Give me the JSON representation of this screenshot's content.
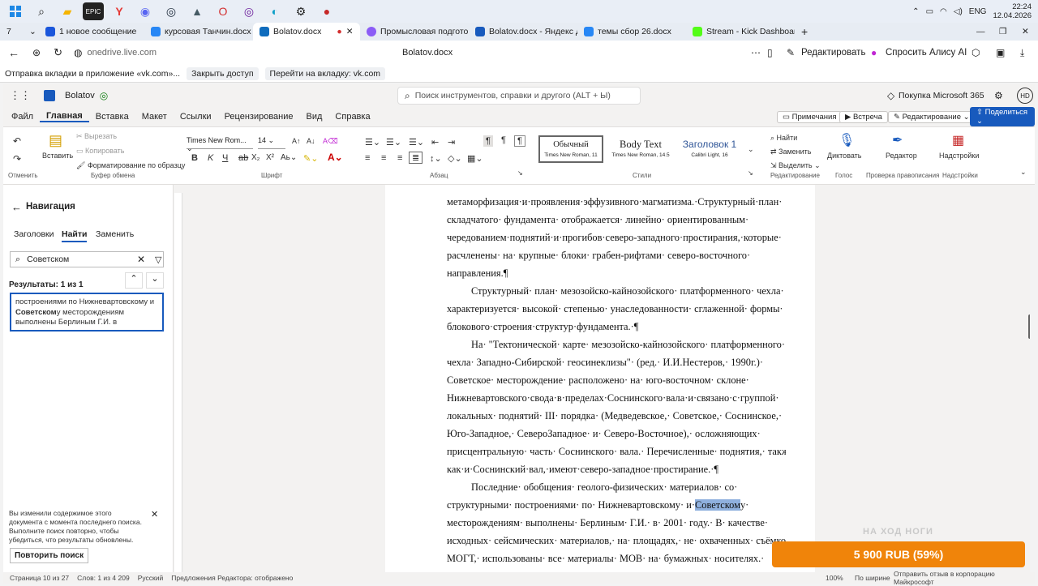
{
  "taskbar": {
    "clock_time": "22:24",
    "clock_date": "12.04.2026",
    "lang": "ENG"
  },
  "browser": {
    "tab_count": "7",
    "tabs": [
      {
        "label": "1 новое сообщение",
        "color": "#1a56db"
      },
      {
        "label": "курсовая Танчин.docx",
        "color": "#2787f5"
      },
      {
        "label": "Bolatov.docx",
        "color": "#0f6cbd"
      },
      {
        "label": "Промысловая подготовк",
        "color": "#8b5cf6"
      },
      {
        "label": "Bolatov.docx - Яндекс До",
        "color": "#185abd"
      },
      {
        "label": "темы сбор 26.docx",
        "color": "#2787f5"
      },
      {
        "label": "Stream - Kick Dashboard",
        "color": "#53fc18"
      }
    ],
    "url": "onedrive.live.com",
    "page_title": "Bolatov.docx",
    "edit_label": "Редактировать",
    "alice_label": "Спросить Алису AI",
    "infobar_text": "Отправка вкладки в приложение «vk.com»...",
    "infobar_close": "Закрыть доступ",
    "infobar_go": "Перейти на вкладку: vk.com"
  },
  "word": {
    "doc_name": "Bolatov",
    "search_placeholder": "Поиск инструментов, справки и другого (ALT + Ы)",
    "buy_label": "Покупка Microsoft 365",
    "avatar": "HD",
    "menu": [
      "Файл",
      "Главная",
      "Вставка",
      "Макет",
      "Ссылки",
      "Рецензирование",
      "Вид",
      "Справка"
    ],
    "actions": {
      "comments": "Примечания",
      "meeting": "Встреча",
      "editing": "Редактирование",
      "share": "Поделиться"
    },
    "ribbon": {
      "undo": "Отменить",
      "paste": "Вставить",
      "cut": "Вырезать",
      "copy": "Копировать",
      "format_painter": "Форматирование по образцу",
      "clipboard": "Буфер обмена",
      "font_name": "Times New Rom...",
      "font_size": "14",
      "font_group": "Шрифт",
      "paragraph_group": "Абзац",
      "styles_group": "Стили",
      "styles": [
        {
          "name": "Обычный",
          "sub": "Times New Roman, 11"
        },
        {
          "name": "Body Text",
          "sub": "Times New Roman, 14.5"
        },
        {
          "name": "Заголовок 1",
          "sub": "Calibri Light, 16"
        }
      ],
      "find": "Найти",
      "replace": "Заменить",
      "select": "Выделить",
      "editing_group": "Редактирование",
      "dictate": "Диктовать",
      "voice_group": "Голос",
      "editor": "Редактор",
      "proofing_group": "Проверка правописания",
      "addins": "Надстройки",
      "addins_group": "Надстройки"
    }
  },
  "nav": {
    "title": "Навигация",
    "tabs": [
      "Заголовки",
      "Найти",
      "Заменить"
    ],
    "search_value": "Советском",
    "results": "Результаты: 1 из 1",
    "result_line1": "построениями по Нижневартовскому и",
    "result_bold": "Советском",
    "result_line2": "у месторождениям",
    "result_line3": "выполнены Берлиным Г.И. в",
    "notice": "Вы изменили содержимое этого документа с момента последнего поиска. Выполните поиск повторно, чтобы убедиться, что результаты обновлены.",
    "repeat_button": "Повторить поиск"
  },
  "document": {
    "lines": [
      "метаморфизация·и·проявления·эффузивного·магматизма.·Структурный·план·",
      "складчатого· фундамента· отображается· линейно· ориентированным·",
      "чередованием·поднятий·и·прогибов·северо-западного·простирания,·которые·",
      "расчленены· на· крупные· блоки· грабен-рифтами· северо-восточного·",
      "направления.¶",
      "Структурный· план· мезозойско-кайнозойского· платформенного· чехла·",
      "характеризуется· высокой· степенью· унаследованности· сглаженной· формы·",
      "блокового·строения·структур·фундамента.·¶",
      "На· \"Тектонической· карте· мезозойско-кайнозойского· платформенного·",
      "чехла· Западно-Сибирской· геосинеклизы\"· (ред.· И.И.Нестеров,· 1990г.)·",
      "Советское· месторождение· расположено· на· юго-восточном· склоне·",
      "Нижневартовского·свода·в·пределах·Соснинского·вала·и·связано·с·группой·",
      "локальных· поднятий· III· порядка· (Медведевское,· Советское,· Соснинское,·",
      "Юго-Западное,· СевероЗападное· и· Северо-Восточное),· осложняющих·",
      "присцентральную· часть· Соснинского· вала.· Перечисленные· поднятия,· также·",
      "как·и·Соснинский·вал,·имеют·северо-западное·простирание.·¶",
      "Последние· обобщения· геолого-физических· материалов· со·",
      "структурными· построениями· по· Нижневартовскому· и·",
      "месторождениям· выполнены· Берлиным· Г.И.· в· 2001· году.· В· качестве·",
      "исходных· сейсмических· материалов,· на· площадях,· не· охваченных· съёмкой·",
      "МОГТ,· использованы· все· материалы· МОВ· на· бумажных· носителях.·"
    ],
    "highlight_word": "Советском",
    "highlight_tail": "у·"
  },
  "status": {
    "page": "Страница 10 из 27",
    "words": "Слов: 1 из 4 209",
    "lang": "Русский",
    "editor": "Предложения Редактора: отображено",
    "zoom": "100%",
    "fit": "По ширине",
    "feedback": "Отправить отзыв в корпорацию Майкрософт"
  },
  "promo": {
    "top": "НА ХОД НОГИ",
    "price": "5 900 RUB (59%)"
  }
}
